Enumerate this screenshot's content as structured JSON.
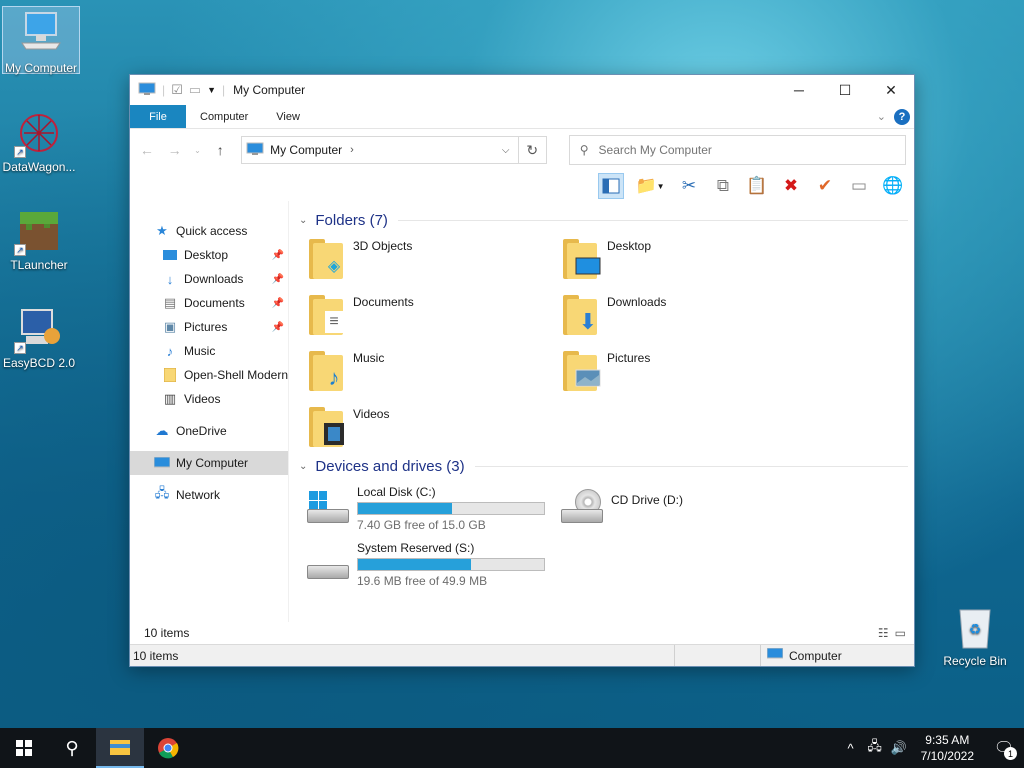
{
  "desktop": {
    "icons": [
      {
        "label": "My Computer"
      },
      {
        "label": "DataWagon..."
      },
      {
        "label": "TLauncher"
      },
      {
        "label": "EasyBCD 2.0"
      },
      {
        "label": "Recycle Bin"
      }
    ]
  },
  "window": {
    "title": "My Computer",
    "tabs": [
      "File",
      "Computer",
      "View"
    ],
    "address": "My Computer",
    "search_placeholder": "Search My Computer",
    "sidebar": {
      "quick_access": "Quick access",
      "items": [
        {
          "label": "Desktop"
        },
        {
          "label": "Downloads"
        },
        {
          "label": "Documents"
        },
        {
          "label": "Pictures"
        },
        {
          "label": "Music"
        },
        {
          "label": "Open-Shell Modern"
        },
        {
          "label": "Videos"
        }
      ],
      "onedrive": "OneDrive",
      "my_computer": "My Computer",
      "network": "Network"
    },
    "folders_header": "Folders (7)",
    "folders": [
      {
        "label": "3D Objects"
      },
      {
        "label": "Desktop"
      },
      {
        "label": "Documents"
      },
      {
        "label": "Downloads"
      },
      {
        "label": "Music"
      },
      {
        "label": "Pictures"
      },
      {
        "label": "Videos"
      }
    ],
    "devices_header": "Devices and drives (3)",
    "drives": [
      {
        "name": "Local Disk (C:)",
        "free": "7.40 GB free of 15.0 GB",
        "used_fraction": 0.507
      },
      {
        "name": "CD Drive (D:)"
      },
      {
        "name": "System Reserved (S:)",
        "free": "19.6 MB free of 49.9 MB",
        "used_fraction": 0.607
      }
    ],
    "item_count": "10 items",
    "status_items": "10 items",
    "status_location": "Computer"
  },
  "taskbar": {
    "time": "9:35 AM",
    "date": "7/10/2022",
    "notification_count": "1"
  },
  "colors": {
    "accent": "#1a86c0",
    "group_header": "#1e3287",
    "drive_bar": "#26a0da"
  }
}
